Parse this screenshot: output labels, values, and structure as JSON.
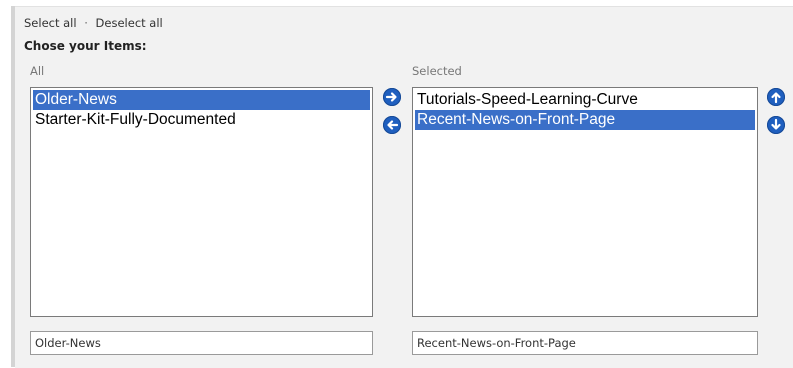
{
  "links": {
    "select_all": "Select all",
    "separator": "·",
    "deselect_all": "Deselect all"
  },
  "title": "Chose your Items:",
  "all_list": {
    "caption": "All",
    "items": [
      "Older-News",
      "Starter-Kit-Fully-Documented"
    ],
    "selected_index": 0
  },
  "selected_list": {
    "caption": "Selected",
    "items": [
      "Tutorials-Speed-Learning-Curve",
      "Recent-News-on-Front-Page"
    ],
    "selected_index": 1
  },
  "fields": {
    "all_value": "Older-News",
    "selected_value": "Recent-News-on-Front-Page"
  },
  "buttons": {
    "move_right": "arrow-right-icon",
    "move_left": "arrow-left-icon",
    "move_up": "arrow-up-icon",
    "move_down": "arrow-down-icon"
  },
  "colors": {
    "selection": "#3a6fc8",
    "button": "#1f5fbf",
    "panel": "#f2f2f2"
  }
}
